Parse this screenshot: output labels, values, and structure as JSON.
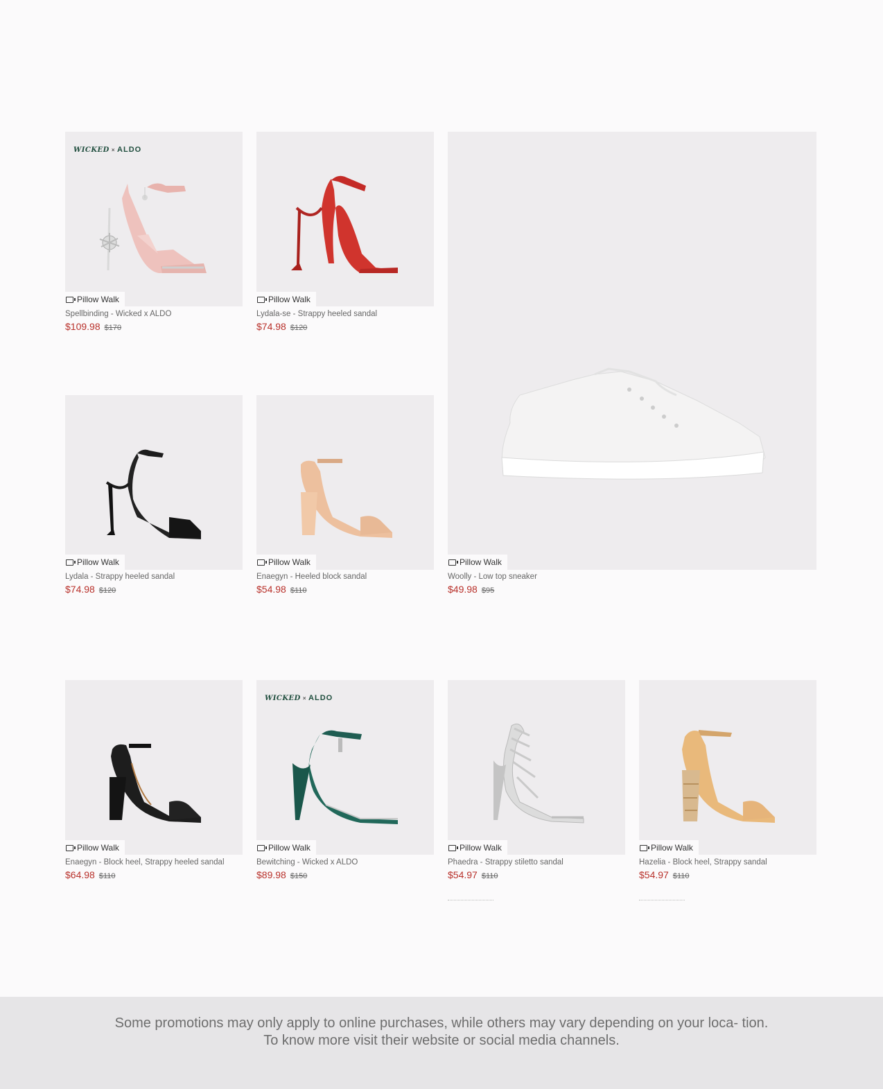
{
  "badge_label": "Pillow Walk",
  "logo": {
    "left": "WICKED",
    "x": "×",
    "right": "ALDO"
  },
  "products": [
    {
      "name": "Spellbinding - Wicked x ALDO",
      "price": "$109.98",
      "original": "$170"
    },
    {
      "name": "Lydala-se - Strappy heeled sandal",
      "price": "$74.98",
      "original": "$120"
    },
    {
      "name": "Lydala - Strappy heeled sandal",
      "price": "$74.98",
      "original": "$120"
    },
    {
      "name": "Enaegyn - Heeled block sandal",
      "price": "$54.98",
      "original": "$110"
    },
    {
      "name": "Woolly - Low top sneaker",
      "price": "$49.98",
      "original": "$95"
    },
    {
      "name": "Enaegyn - Block heel, Strappy heeled sandal",
      "price": "$64.98",
      "original": "$110"
    },
    {
      "name": "Bewitching - Wicked x ALDO",
      "price": "$89.98",
      "original": "$150"
    },
    {
      "name": "Phaedra - Strappy stiletto sandal",
      "price": "$54.97",
      "original": "$110"
    },
    {
      "name": "Hazelia - Block heel, Strappy sandal",
      "price": "$54.97",
      "original": "$110"
    }
  ],
  "footer_text": "Some promotions may only apply to online purchases, while others may vary depending on your loca- tion. To know more visit their website or social media channels.",
  "colors": {
    "sale": "#b8302a",
    "card_bg": "#eeecee",
    "footer_bg": "#e6e5e7"
  }
}
